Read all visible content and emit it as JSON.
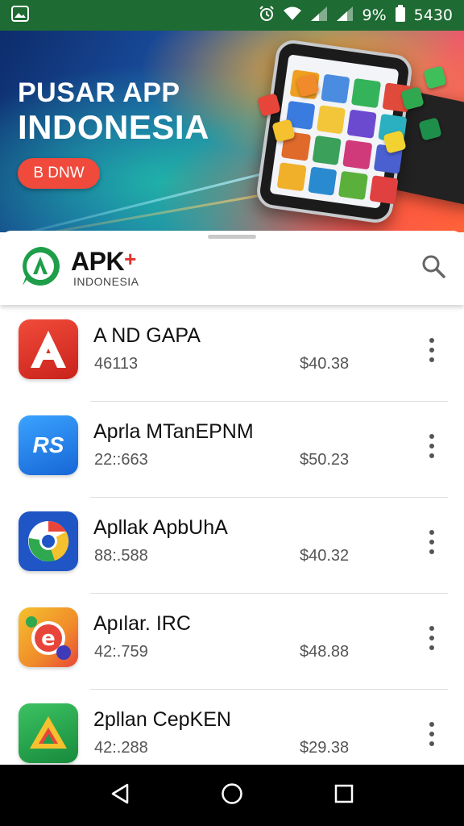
{
  "status_bar": {
    "battery_percent": "9%",
    "time": "5430",
    "icons": [
      "gallery-icon",
      "alarm-icon",
      "wifi-icon",
      "signal-icon",
      "battery-icon"
    ]
  },
  "hero": {
    "title_line1": "PUSAR APP",
    "title_line2": "INDONESIA",
    "button_label": "B DNW",
    "carousel": {
      "total": 3,
      "active": 1
    }
  },
  "header": {
    "brand_main": "APK",
    "brand_plus": "+",
    "brand_sub": "INDONESIA",
    "search_icon": "search-icon",
    "colors": {
      "logo": "#1f9e4a",
      "plus": "#e0332c"
    }
  },
  "apps": [
    {
      "name": "A ND GAPA",
      "meta": "46113",
      "price": "$40.38",
      "icon": "letter-a-icon"
    },
    {
      "name": "Aprla MTanEPNM",
      "meta": "22::663",
      "price": "$50.23",
      "icon": "rs-icon"
    },
    {
      "name": "Apllak ApbUhA",
      "meta": "88:.588",
      "price": "$40.32",
      "icon": "chrome-like-icon"
    },
    {
      "name": "Apılar. IRC",
      "meta": "42:.759",
      "price": "$48.88",
      "icon": "letter-e-icon"
    },
    {
      "name": "2pllan CepKEN",
      "meta": "42:.288",
      "price": "$29.38",
      "icon": "triangle-icon"
    }
  ],
  "nav": {
    "buttons": [
      "back-icon",
      "home-icon",
      "recents-icon"
    ]
  }
}
